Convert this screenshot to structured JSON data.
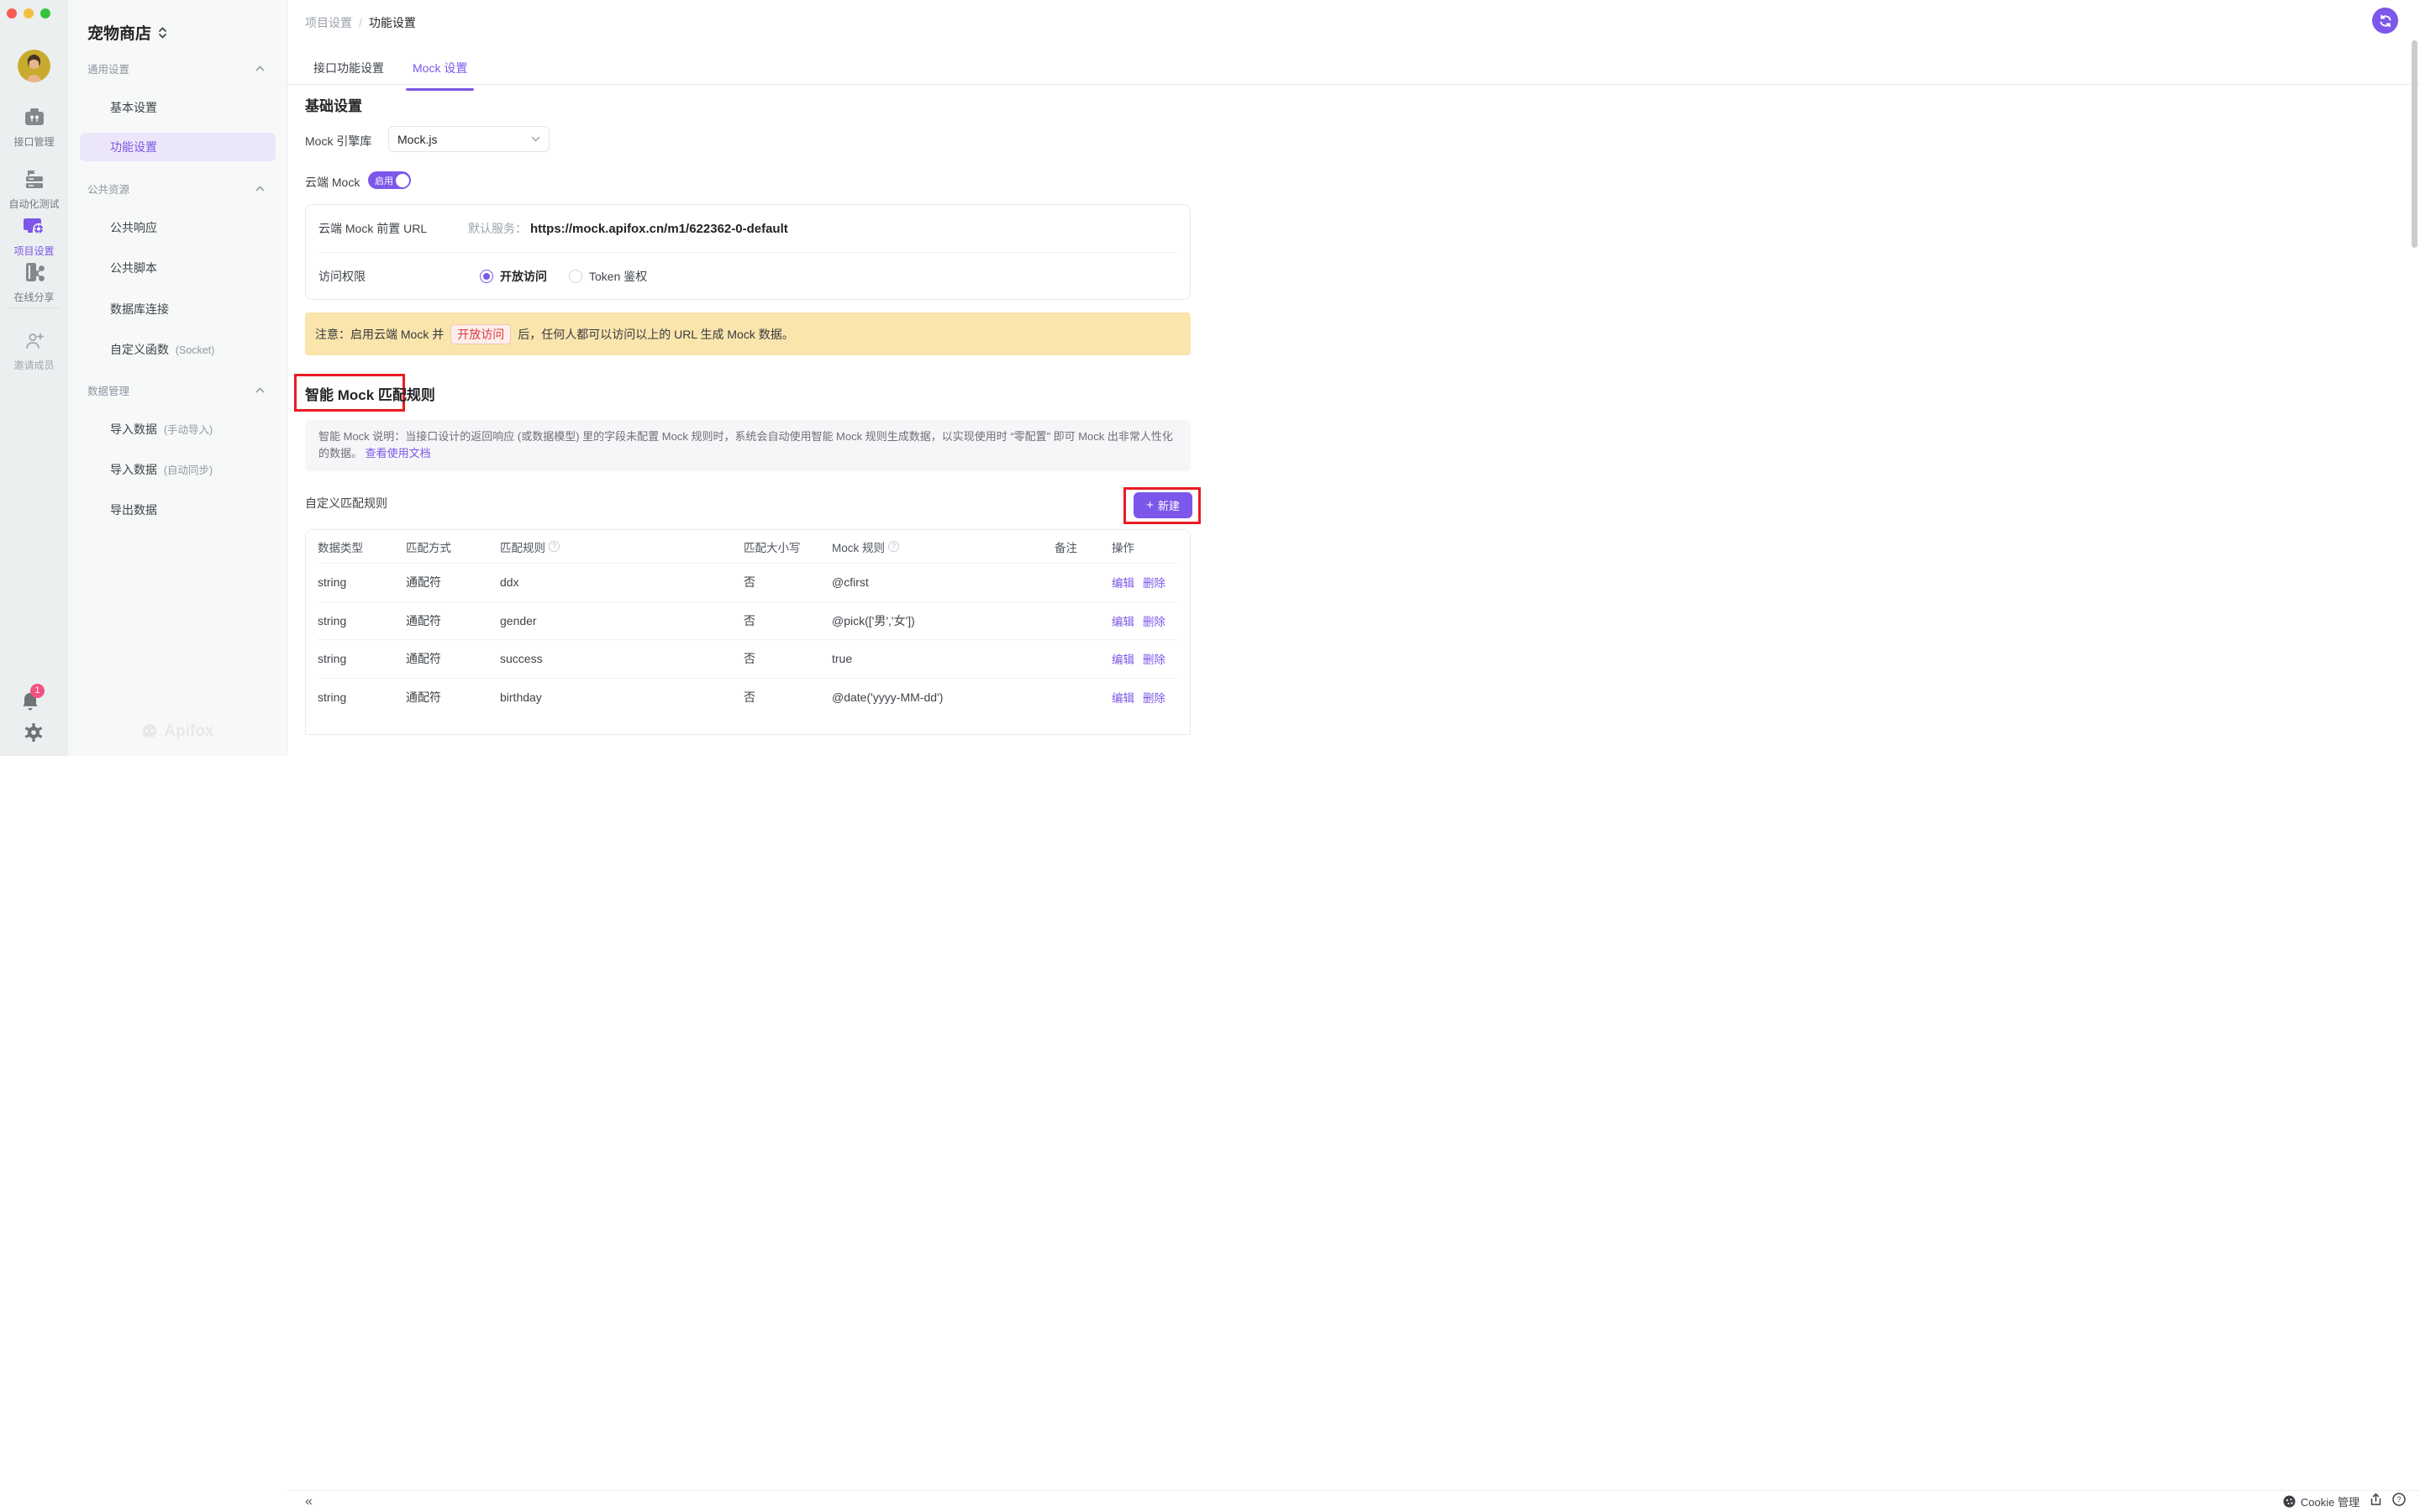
{
  "colors": {
    "accent": "#7c57ea",
    "banner_bg": "#fae5ad",
    "danger_text": "#df383e",
    "annotation_red": "#ea1b22",
    "active_item_bg": "#ece6f9"
  },
  "rail": {
    "items": [
      {
        "label": "接口管理",
        "icon": "api-management-icon",
        "active": false
      },
      {
        "label": "自动化测试",
        "icon": "automated-testing-icon",
        "active": false
      },
      {
        "label": "项目设置",
        "icon": "project-settings-icon",
        "active": true
      },
      {
        "label": "在线分享",
        "icon": "online-share-icon",
        "active": false
      }
    ],
    "invite_label": "邀请成员",
    "notification_badge": "1"
  },
  "sidebar": {
    "project_name": "宠物商店",
    "groups": [
      {
        "label": "通用设置"
      },
      {
        "label": "公共资源"
      },
      {
        "label": "数据管理"
      }
    ],
    "general_items": [
      {
        "label": "基本设置"
      },
      {
        "label": "功能设置"
      }
    ],
    "resource_items": [
      {
        "label": "公共响应",
        "suffix": ""
      },
      {
        "label": "公共脚本",
        "suffix": ""
      },
      {
        "label": "数据库连接",
        "suffix": ""
      },
      {
        "label": "自定义函数",
        "suffix": "(Socket)"
      }
    ],
    "data_items": [
      {
        "label": "导入数据",
        "suffix": "(手动导入)"
      },
      {
        "label": "导入数据",
        "suffix": "(自动同步)"
      },
      {
        "label": "导出数据",
        "suffix": ""
      }
    ],
    "watermark": "Apifox"
  },
  "main": {
    "breadcrumb": {
      "parent": "项目设置",
      "separator": "/",
      "current": "功能设置"
    },
    "tabs": [
      {
        "label": "接口功能设置"
      },
      {
        "label": "Mock 设置"
      }
    ],
    "basic": {
      "title": "基础设置",
      "engine_label": "Mock 引擎库",
      "engine_value": "Mock.js",
      "cloud_mock_label": "云端 Mock",
      "toggle_label": "启用",
      "url_row_label": "云端 Mock 前置 URL",
      "url_prefix": "默认服务：",
      "url_value": "https://mock.apifox.cn/m1/622362-0-default",
      "access_label": "访问权限",
      "radio_open": "开放访问",
      "radio_token": "Token 鉴权",
      "notice_prefix": "注意：启用云端 Mock 并",
      "notice_highlight": "开放访问",
      "notice_suffix": "后，任何人都可以访问以上的 URL 生成 Mock 数据。"
    },
    "smart": {
      "title": "智能 Mock 匹配规则",
      "description": "智能 Mock 说明：当接口设计的返回响应 (或数据模型) 里的字段未配置 Mock 规则时，系统会自动使用智能 Mock 规则生成数据，以实现使用时 “零配置” 即可 Mock 出非常人性化的数据。",
      "doc_link": "查看使用文档",
      "custom_rules_label": "自定义匹配规则",
      "new_button_plus": "+",
      "new_button": "新建"
    },
    "table": {
      "headers": [
        "数据类型",
        "匹配方式",
        "匹配规则",
        "匹配大小写",
        "Mock 规则",
        "备注",
        "操作"
      ],
      "help_icon_glyph": "?",
      "rows": [
        {
          "type": "string",
          "method": "通配符",
          "rule": "ddx",
          "case": "否",
          "mock": "@cfirst",
          "note": ""
        },
        {
          "type": "string",
          "method": "通配符",
          "rule": "gender",
          "case": "否",
          "mock": "@pick(['男','女'])",
          "note": ""
        },
        {
          "type": "string",
          "method": "通配符",
          "rule": "success",
          "case": "否",
          "mock": "true",
          "note": ""
        },
        {
          "type": "string",
          "method": "通配符",
          "rule": "birthday",
          "case": "否",
          "mock": "@date('yyyy-MM-dd')",
          "note": ""
        }
      ],
      "actions": {
        "edit": "编辑",
        "delete": "删除"
      }
    },
    "footer": {
      "collapse_glyph": "«",
      "cookie_label": "Cookie 管理"
    }
  }
}
